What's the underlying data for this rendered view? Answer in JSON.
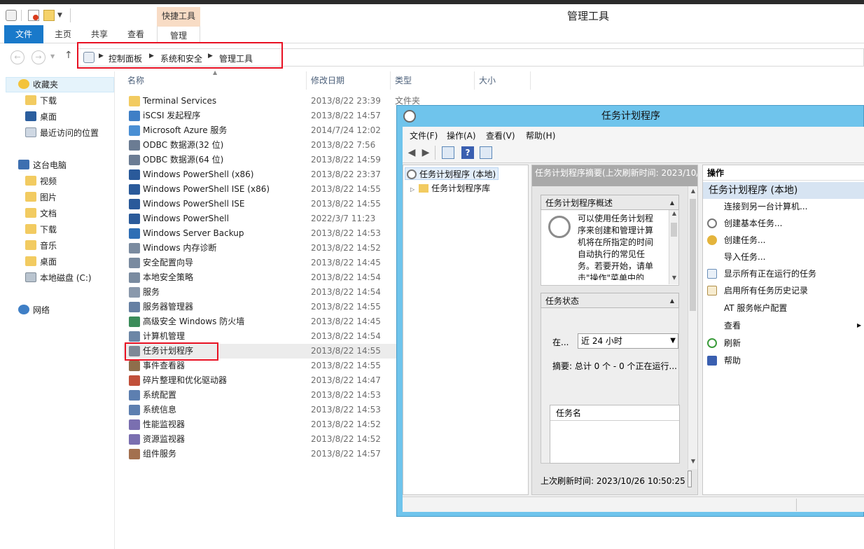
{
  "window": {
    "title": "管理工具",
    "contextual_tab_group": "快捷工具"
  },
  "ribbon": {
    "tabs": [
      {
        "label": "文件"
      },
      {
        "label": "主页"
      },
      {
        "label": "共享"
      },
      {
        "label": "查看"
      },
      {
        "label": "管理"
      }
    ]
  },
  "address": {
    "crumbs": [
      "控制面板",
      "系统和安全",
      "管理工具"
    ]
  },
  "nav": {
    "favorites": "收藏夹",
    "favorites_items": [
      "下载",
      "桌面",
      "最近访问的位置"
    ],
    "thispc": "这台电脑",
    "thispc_items": [
      "视频",
      "图片",
      "文档",
      "下载",
      "音乐",
      "桌面",
      "本地磁盘 (C:)"
    ],
    "network": "网络"
  },
  "filelist": {
    "columns": [
      "名称",
      "修改日期",
      "类型",
      "大小"
    ],
    "rows": [
      {
        "name": "Terminal Services",
        "date": "2013/8/22 23:39",
        "type": "文件夹"
      },
      {
        "name": "iSCSI 发起程序",
        "date": "2013/8/22 14:57",
        "type": ""
      },
      {
        "name": "Microsoft Azure 服务",
        "date": "2014/7/24 12:02",
        "type": ""
      },
      {
        "name": "ODBC 数据源(32 位)",
        "date": "2013/8/22 7:56",
        "type": ""
      },
      {
        "name": "ODBC 数据源(64 位)",
        "date": "2013/8/22 14:59",
        "type": ""
      },
      {
        "name": "Windows PowerShell (x86)",
        "date": "2013/8/22 23:37",
        "type": ""
      },
      {
        "name": "Windows PowerShell ISE (x86)",
        "date": "2013/8/22 14:55",
        "type": ""
      },
      {
        "name": "Windows PowerShell ISE",
        "date": "2013/8/22 14:55",
        "type": ""
      },
      {
        "name": "Windows PowerShell",
        "date": "2022/3/7 11:23",
        "type": ""
      },
      {
        "name": "Windows Server Backup",
        "date": "2013/8/22 14:53",
        "type": ""
      },
      {
        "name": "Windows 内存诊断",
        "date": "2013/8/22 14:52",
        "type": ""
      },
      {
        "name": "安全配置向导",
        "date": "2013/8/22 14:45",
        "type": ""
      },
      {
        "name": "本地安全策略",
        "date": "2013/8/22 14:54",
        "type": ""
      },
      {
        "name": "服务",
        "date": "2013/8/22 14:54",
        "type": ""
      },
      {
        "name": "服务器管理器",
        "date": "2013/8/22 14:55",
        "type": ""
      },
      {
        "name": "高级安全 Windows 防火墙",
        "date": "2013/8/22 14:45",
        "type": ""
      },
      {
        "name": "计算机管理",
        "date": "2013/8/22 14:54",
        "type": ""
      },
      {
        "name": "任务计划程序",
        "date": "2013/8/22 14:55",
        "type": ""
      },
      {
        "name": "事件查看器",
        "date": "2013/8/22 14:55",
        "type": ""
      },
      {
        "name": "碎片整理和优化驱动器",
        "date": "2013/8/22 14:47",
        "type": ""
      },
      {
        "name": "系统配置",
        "date": "2013/8/22 14:53",
        "type": ""
      },
      {
        "name": "系统信息",
        "date": "2013/8/22 14:53",
        "type": ""
      },
      {
        "name": "性能监视器",
        "date": "2013/8/22 14:52",
        "type": ""
      },
      {
        "name": "资源监视器",
        "date": "2013/8/22 14:52",
        "type": ""
      },
      {
        "name": "组件服务",
        "date": "2013/8/22 14:57",
        "type": ""
      }
    ],
    "selected_index": 17
  },
  "tasksched": {
    "title": "任务计划程序",
    "menu": [
      "文件(F)",
      "操作(A)",
      "查看(V)",
      "帮助(H)"
    ],
    "tree": [
      "任务计划程序 (本地)",
      "任务计划程序库"
    ],
    "summary_header": "任务计划程序摘要(上次刷新时间: 2023/10/2",
    "overview_title": "任务计划程序概述",
    "overview_text": "可以使用任务计划程序来创建和管理计算机将在所指定的时间自动执行的常见任务。若要开始，请单击\"操作\"菜单中的",
    "status_title": "任务状态",
    "status_label": "在...",
    "status_combo": "近 24 小时",
    "status_summary": "摘要: 总计 0 个 - 0 个正在运行...",
    "grid_column": "任务名",
    "last_refresh": "上次刷新时间: 2023/10/26 10:50:25",
    "actions_title": "操作",
    "actions_group": "任务计划程序 (本地)",
    "actions": [
      "连接到另一台计算机...",
      "创建基本任务...",
      "创建任务...",
      "导入任务...",
      "显示所有正在运行的任务",
      "启用所有任务历史记录",
      "AT 服务帐户配置",
      "查看",
      "刷新",
      "帮助"
    ]
  },
  "colors": {
    "ribbon_file": "#1979ca",
    "context_tab": "#f8dcc5",
    "highlight_red": "#e81123",
    "dialog_frame": "#6fc4ec"
  }
}
